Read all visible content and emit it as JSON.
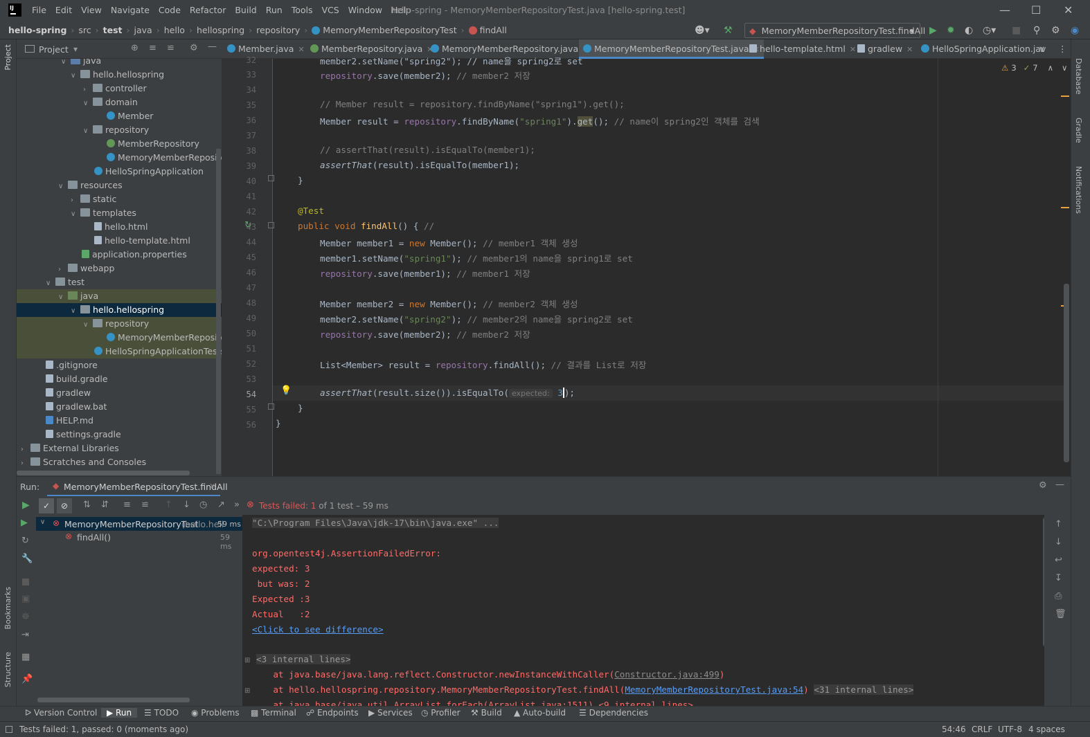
{
  "app": {
    "logo": "IJ",
    "title": "hello-spring - MemoryMemberRepositoryTest.java [hello-spring.test]"
  },
  "menu": [
    "File",
    "Edit",
    "View",
    "Navigate",
    "Code",
    "Refactor",
    "Build",
    "Run",
    "Tools",
    "VCS",
    "Window",
    "Help"
  ],
  "breadcrumb": [
    "hello-spring",
    "src",
    "test",
    "java",
    "hello",
    "hellospring",
    "repository",
    "MemoryMemberRepositoryTest",
    "findAll"
  ],
  "run_config": "MemoryMemberRepositoryTest.findAll",
  "project_panel": {
    "title": "Project"
  },
  "tree": [
    {
      "label": "java",
      "icon": "folder-b"
    },
    {
      "label": "hello.hellospring",
      "icon": "folder"
    },
    {
      "label": "controller",
      "icon": "folder"
    },
    {
      "label": "domain",
      "icon": "folder"
    },
    {
      "label": "Member",
      "icon": "class"
    },
    {
      "label": "repository",
      "icon": "folder"
    },
    {
      "label": "MemberRepository",
      "icon": "interface"
    },
    {
      "label": "MemoryMemberRepository",
      "icon": "class"
    },
    {
      "label": "HelloSpringApplication",
      "icon": "class"
    },
    {
      "label": "resources",
      "icon": "folder"
    },
    {
      "label": "static",
      "icon": "folder"
    },
    {
      "label": "templates",
      "icon": "folder"
    },
    {
      "label": "hello.html",
      "icon": "file"
    },
    {
      "label": "hello-template.html",
      "icon": "file"
    },
    {
      "label": "application.properties",
      "icon": "file"
    },
    {
      "label": "webapp",
      "icon": "folder"
    },
    {
      "label": "test",
      "icon": "folder"
    },
    {
      "label": "java",
      "icon": "folder-g"
    },
    {
      "label": "hello.hellospring",
      "icon": "folder"
    },
    {
      "label": "repository",
      "icon": "folder"
    },
    {
      "label": "MemoryMemberRepository",
      "icon": "class"
    },
    {
      "label": "HelloSpringApplicationTests",
      "icon": "class"
    },
    {
      "label": ".gitignore",
      "icon": "file"
    },
    {
      "label": "build.gradle",
      "icon": "file"
    },
    {
      "label": "gradlew",
      "icon": "file"
    },
    {
      "label": "gradlew.bat",
      "icon": "file"
    },
    {
      "label": "HELP.md",
      "icon": "file"
    },
    {
      "label": "settings.gradle",
      "icon": "file"
    },
    {
      "label": "External Libraries",
      "icon": "lib"
    },
    {
      "label": "Scratches and Consoles",
      "icon": "scratch"
    }
  ],
  "tabs": [
    "Member.java",
    "MemberRepository.java",
    "MemoryMemberRepository.java",
    "MemoryMemberRepositoryTest.java",
    "hello-template.html",
    "gradlew",
    "HelloSpringApplication.jav"
  ],
  "inspections": {
    "warnings": "3",
    "weak": "7"
  },
  "code": {
    "l32": "member2.setName(\"spring2\"); // name을 spring2로 set",
    "l33a": "repository",
    "l33b": ".save(member2); ",
    "l33c": "// member2 저장",
    "l35": "// Member result = repository.findByName(\"spring1\").get();",
    "l36a": "Member result = ",
    "l36b": "repository",
    "l36c": ".findByName(",
    "l36d": "\"spring1\"",
    "l36e": ").",
    "l36f": "get",
    "l36g": "(); ",
    "l36h": "// name이 spring2인 객체를 검색",
    "l38": "// assertThat(result).isEqualTo(member1);",
    "l39a": "assertThat",
    "l39b": "(result).isEqualTo(member1);",
    "l40": "}",
    "l42": "@Test",
    "l43a": "public void ",
    "l43b": "findAll",
    "l43c": "() { ",
    "l43d": "//",
    "l44a": "Member member1 = ",
    "l44b": "new ",
    "l44c": "Member(); ",
    "l44d": "// member1 객체 생성",
    "l45a": "member1.setName(",
    "l45b": "\"spring1\"",
    "l45c": "); ",
    "l45d": "// member1의 name을 spring1로 set",
    "l46a": "repository",
    "l46b": ".save(member1); ",
    "l46c": "// member1 저장",
    "l48a": "Member member2 = ",
    "l48b": "new ",
    "l48c": "Member(); ",
    "l48d": "// member2 객체 생성",
    "l49a": "member2.setName(",
    "l49b": "\"spring2\"",
    "l49c": "); ",
    "l49d": "// member2의 name을 spring2로 set",
    "l50a": "repository",
    "l50b": ".save(member2); ",
    "l50c": "// member2 저장",
    "l52a": "List<Member> result = ",
    "l52b": "repository",
    "l52c": ".findAll(); ",
    "l52d": "// 결과를 List로 저장",
    "l54a": "assertThat",
    "l54b": "(result.size()).isEqualTo(",
    "l54hint": "expected:",
    "l54c": "3",
    "l54d": ");",
    "l55": "}",
    "l56": "}"
  },
  "line_numbers": [
    "32",
    "33",
    "34",
    "35",
    "36",
    "37",
    "38",
    "39",
    "40",
    "41",
    "42",
    "43",
    "44",
    "45",
    "46",
    "47",
    "48",
    "49",
    "50",
    "51",
    "52",
    "53",
    "54",
    "55",
    "56"
  ],
  "run_panel": {
    "label": "Run:",
    "tab": "MemoryMemberRepositoryTest.findAll",
    "status": "Tests failed:",
    "status_count": "1",
    "status_rest": "of 1 test – 59 ms"
  },
  "test_tree": [
    {
      "name": "MemoryMemberRepositoryTest",
      "pkg": "(hello.hell",
      "time": "59 ms"
    },
    {
      "name": "findAll()",
      "pkg": "",
      "time": "59 ms"
    }
  ],
  "console": {
    "cmd": "\"C:\\Program Files\\Java\\jdk-17\\bin\\java.exe\" ...",
    "e1": "org.opentest4j.AssertionFailedError:",
    "e2": "expected: 3",
    "e3": " but was: 2",
    "e4": "Expected :3",
    "e5": "Actual   :2",
    "diff": "<Click to see difference>",
    "internal1": "<3 internal lines>",
    "at1a": "    at java.base/java.lang.reflect.Constructor.newInstanceWithCaller(",
    "at1b": "Constructor.java:499",
    "at1c": ")",
    "at2a": "    at hello.hellospring.repository.MemoryMemberRepositoryTest.findAll(",
    "at2b": "MemoryMemberRepositoryTest.java:54",
    "at2c": ")",
    "internal2": "<31 internal lines>",
    "at3": "    at java.base/java.util.ArrayList.forEach(ArrayList.java:1511) <9 internal lines>"
  },
  "toolwindows": [
    "Version Control",
    "Run",
    "TODO",
    "Problems",
    "Terminal",
    "Endpoints",
    "Services",
    "Profiler",
    "Build",
    "Auto-build",
    "Dependencies"
  ],
  "right_strip": [
    "Database",
    "Gradle",
    "Notifications"
  ],
  "left_strip": [
    "Project",
    "Bookmarks",
    "Structure"
  ],
  "statusbar": {
    "message": "Tests failed: 1, passed: 0 (moments ago)",
    "position": "54:46",
    "line_sep": "CRLF",
    "encoding": "UTF-8",
    "indent": "4 spaces"
  }
}
